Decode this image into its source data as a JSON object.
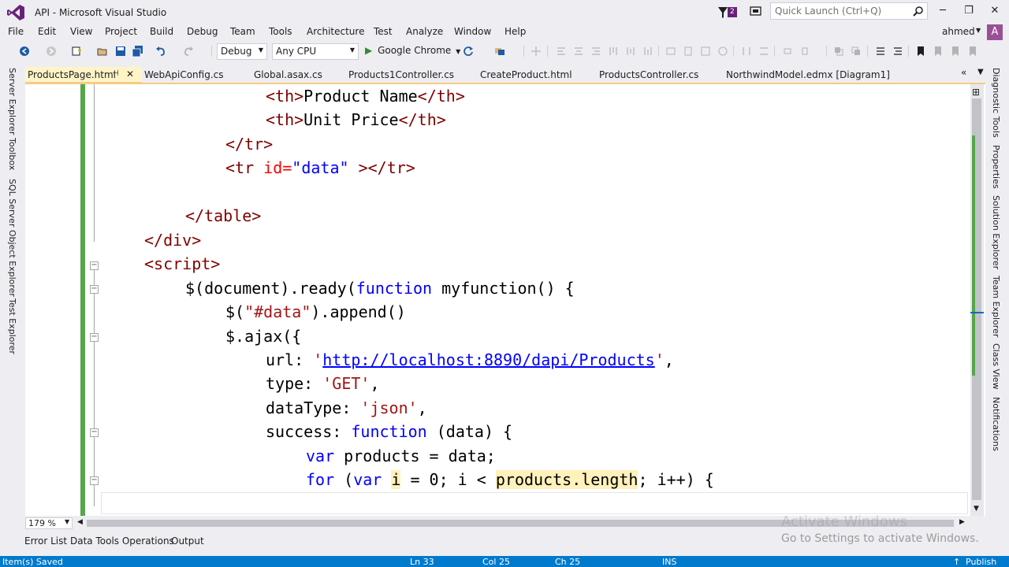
{
  "window": {
    "title": "API - Microsoft Visual Studio",
    "notification_count": "2",
    "quick_launch_placeholder": "Quick Launch (Ctrl+Q)",
    "minimize_glyph": "─",
    "maximize_glyph": "❐",
    "close_glyph": "✕"
  },
  "menu": {
    "items": [
      "File",
      "Edit",
      "View",
      "Project",
      "Build",
      "Debug",
      "Team",
      "Tools",
      "Architecture",
      "Test",
      "Analyze",
      "Window",
      "Help"
    ],
    "user": "ahmed",
    "avatar_initial": "A"
  },
  "toolbar": {
    "configuration": "Debug",
    "platform": "Any CPU",
    "start_target": "Google Chrome"
  },
  "tabs": {
    "active": "ProductsPage.html",
    "others": [
      "WebApiConfig.cs",
      "Global.asax.cs",
      "Products1Controller.cs",
      "CreateProduct.html",
      "ProductsController.cs",
      "NorthwindModel.edmx [Diagram1]"
    ]
  },
  "left_panel": [
    "Server Explorer",
    "Toolbox",
    "SQL Server Object Explorer",
    "Test Explorer"
  ],
  "right_panel": [
    "Diagnostic Tools",
    "Properties",
    "Solution Explorer",
    "Team Explorer",
    "Class View",
    "Notifications"
  ],
  "code": {
    "l1_tag_open": "<th>",
    "l1_text": "Product Name",
    "l1_tag_close": "</th>",
    "l2_tag_open": "<th>",
    "l2_text": "Unit Price",
    "l2_tag_close": "</th>",
    "l3": "</tr>",
    "l4_tag": "<tr",
    "l4_attr": " id=",
    "l4_val": "\"data\"",
    "l4_end": " ></tr>",
    "l6": "</table>",
    "l7": "</div>",
    "l8": "<script>",
    "l9_a": "$(document).ready(",
    "l9_kw": "function",
    "l9_b": " myfunction() {",
    "l10_a": "$(",
    "l10_str": "\"#data\"",
    "l10_b": ").append()",
    "l11": "$.ajax({",
    "l12_key": "url: ",
    "l12_q1": "'",
    "l12_url": "http://localhost:8890/dapi/Products",
    "l12_q2": "'",
    "l12_end": ",",
    "l13_key": "type: ",
    "l13_str": "'GET'",
    "l13_end": ",",
    "l14_key": "dataType: ",
    "l14_str": "'json'",
    "l14_end": ",",
    "l15_key": "success: ",
    "l15_kw": "function",
    "l15_end": " (data) {",
    "l16_kw": "var",
    "l16_end": " products = data;",
    "l17_kw1": "for",
    "l17_a": " (",
    "l17_kw2": "var",
    "l17_b": " ",
    "l17_i": "i",
    "l17_c": " = 0; i < ",
    "l17_hl": "products.length",
    "l17_d": "; i++) {"
  },
  "editor": {
    "zoom": "179 %"
  },
  "watermark": {
    "line1": "Activate Windows",
    "line2": "Go to Settings to activate Windows."
  },
  "bottom_tabs": [
    "Error List",
    "Data Tools Operations",
    "Output"
  ],
  "status": {
    "message": "Item(s) Saved",
    "ln": "Ln 33",
    "col": "Col 25",
    "ch": "Ch 25",
    "mode": "INS",
    "publish": "Publish"
  },
  "colors": {
    "accent": "#007acc",
    "vs_purple": "#68217a",
    "change_bar": "#57a64a",
    "tab_active": "#fff4c8"
  }
}
